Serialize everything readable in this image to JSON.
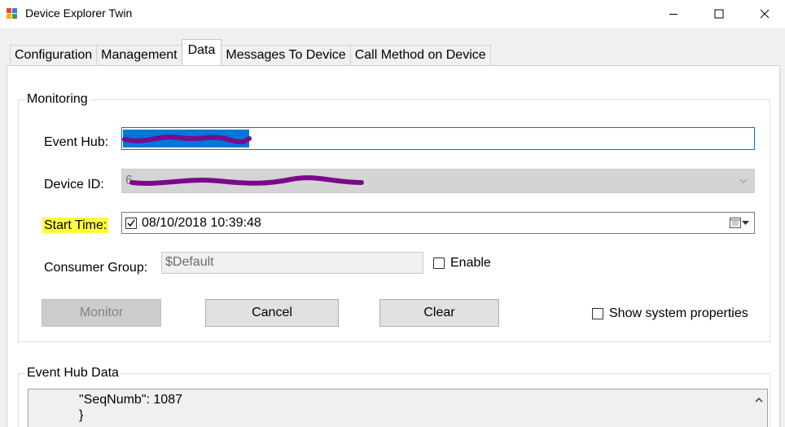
{
  "window": {
    "title": "Device Explorer Twin",
    "minimize_icon": "minimize-icon",
    "maximize_icon": "maximize-icon",
    "close_icon": "close-icon"
  },
  "tabs": [
    {
      "label": "Configuration",
      "active": false
    },
    {
      "label": "Management",
      "active": false
    },
    {
      "label": "Data",
      "active": true
    },
    {
      "label": "Messages To Device",
      "active": false
    },
    {
      "label": "Call Method on Device",
      "active": false
    }
  ],
  "monitoring": {
    "legend": "Monitoring",
    "event_hub_label": "Event Hub:",
    "device_id_label": "Device ID:",
    "device_id_visible_prefix": "6",
    "start_time_label": "Start Time:",
    "start_time_checked": true,
    "start_time_value": "08/10/2018 10:39:48",
    "consumer_group_label": "Consumer Group:",
    "consumer_group_value": "$Default",
    "enable_label": "Enable",
    "enable_checked": false
  },
  "buttons": {
    "monitor": "Monitor",
    "cancel": "Cancel",
    "clear": "Clear"
  },
  "show_system_properties": {
    "label": "Show system properties",
    "checked": false
  },
  "event_hub_data": {
    "legend": "Event Hub Data",
    "lines": [
      "\"SeqNumb\": 1087",
      "}"
    ]
  },
  "colors": {
    "highlight": "#ffff3a",
    "focus_border": "#0078d7",
    "selection": "#0078d7",
    "redaction": "#7b0a8a"
  }
}
